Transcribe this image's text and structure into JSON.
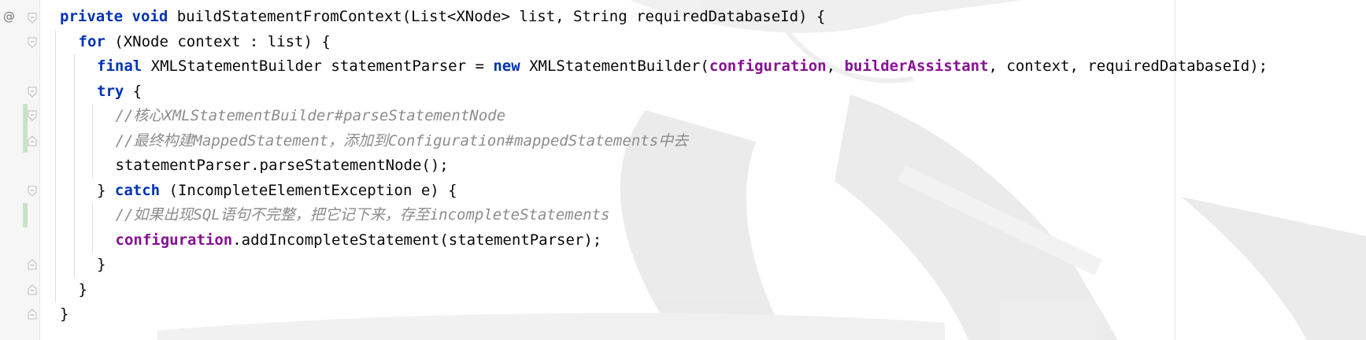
{
  "gutter": {
    "annotation_marker": "@"
  },
  "code": {
    "lines": [
      {
        "indent": 0,
        "tokens": [
          {
            "t": "private",
            "c": "kw"
          },
          {
            "t": " "
          },
          {
            "t": "void",
            "c": "kw"
          },
          {
            "t": " buildStatementFromContext(List<XNode> list, String requiredDatabaseId) {"
          }
        ]
      },
      {
        "indent": 1,
        "tokens": [
          {
            "t": "for",
            "c": "kw"
          },
          {
            "t": " (XNode context : list) {"
          }
        ]
      },
      {
        "indent": 2,
        "tokens": [
          {
            "t": "final",
            "c": "kw"
          },
          {
            "t": " XMLStatementBuilder statementParser = "
          },
          {
            "t": "new",
            "c": "kw"
          },
          {
            "t": " XMLStatementBuilder("
          },
          {
            "t": "configuration",
            "c": "field"
          },
          {
            "t": ", "
          },
          {
            "t": "builderAssistant",
            "c": "field"
          },
          {
            "t": ", context, requiredDatabaseId);"
          }
        ]
      },
      {
        "indent": 2,
        "tokens": [
          {
            "t": "try",
            "c": "kw"
          },
          {
            "t": " {"
          }
        ]
      },
      {
        "indent": 3,
        "tokens": [
          {
            "t": "//核心XMLStatementBuilder#parseStatementNode",
            "c": "cm"
          }
        ]
      },
      {
        "indent": 3,
        "tokens": [
          {
            "t": "//最终构建MappedStatement，添加到Configuration#mappedStatements中去",
            "c": "cm"
          }
        ]
      },
      {
        "indent": 3,
        "tokens": [
          {
            "t": "statementParser.parseStatementNode();"
          }
        ]
      },
      {
        "indent": 2,
        "tokens": [
          {
            "t": "} "
          },
          {
            "t": "catch",
            "c": "kw"
          },
          {
            "t": " (IncompleteElementException e) {"
          }
        ]
      },
      {
        "indent": 3,
        "tokens": [
          {
            "t": "//如果出现SQL语句不完整，把它记下来，存至incompleteStatements",
            "c": "cm"
          }
        ]
      },
      {
        "indent": 3,
        "tokens": [
          {
            "t": "configuration",
            "c": "field"
          },
          {
            "t": ".addIncompleteStatement(statementParser);"
          }
        ]
      },
      {
        "indent": 2,
        "tokens": [
          {
            "t": "}"
          }
        ]
      },
      {
        "indent": 1,
        "tokens": [
          {
            "t": "}"
          }
        ]
      },
      {
        "indent": 0,
        "tokens": [
          {
            "t": "}"
          }
        ]
      }
    ]
  },
  "colors": {
    "keyword": "#0033b3",
    "field": "#871094",
    "comment": "#8c8c8c",
    "text": "#080808",
    "change_bar": "#c9e3c2"
  }
}
